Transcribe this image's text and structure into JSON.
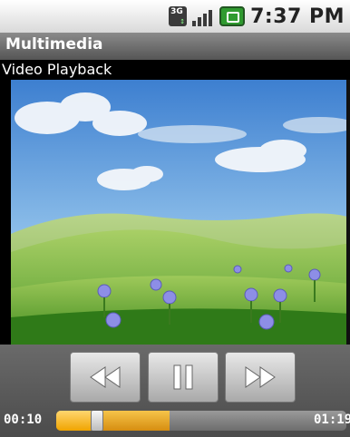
{
  "status_bar": {
    "network_type": "3G",
    "network_sub": "↕",
    "time": "7:37 PM",
    "icons": [
      "network-3g-icon",
      "signal-strength-icon",
      "battery-charging-icon"
    ]
  },
  "app": {
    "title": "Multimedia",
    "subtitle": "Video Playback"
  },
  "player": {
    "buttons": [
      {
        "name": "rewind",
        "icon": "rewind-icon"
      },
      {
        "name": "pause",
        "icon": "pause-icon"
      },
      {
        "name": "fast-forward",
        "icon": "fast-forward-icon"
      }
    ],
    "elapsed": "00:10",
    "total": "01:19",
    "progress_fraction": 0.14,
    "buffered_fraction": 0.39
  },
  "colors": {
    "seek_accent": "#f0a400",
    "title_bar": "#6e6e6e"
  }
}
